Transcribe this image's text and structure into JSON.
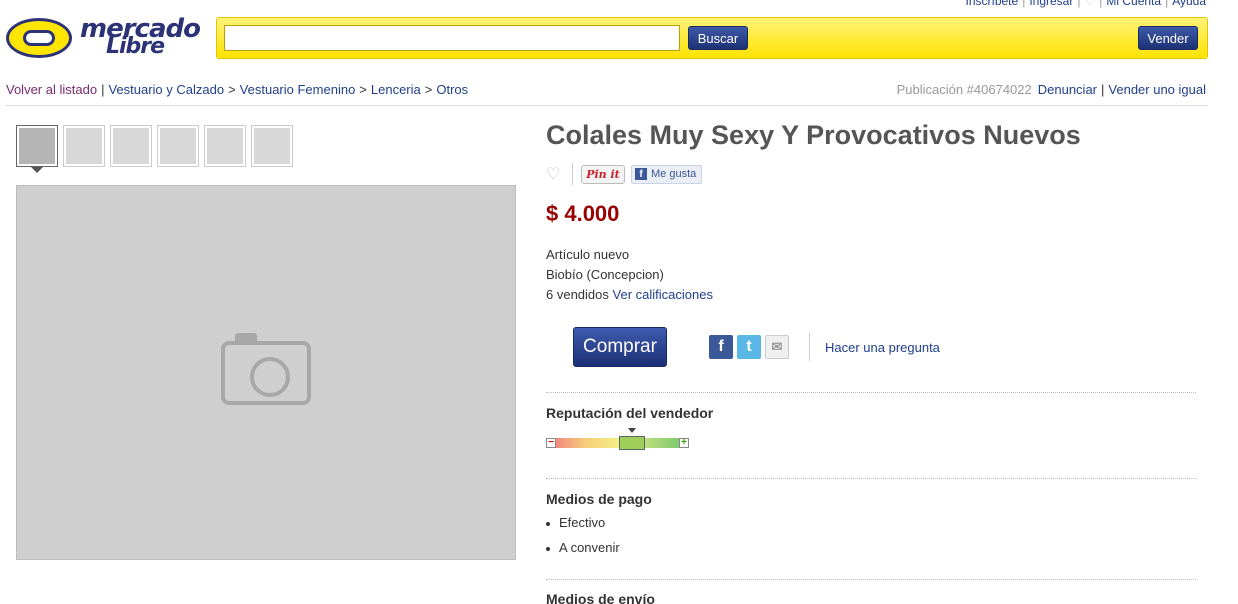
{
  "top_links": {
    "signup": "Inscríbete",
    "login": "Ingresar",
    "account": "Mi Cuenta",
    "help": "Ayuda"
  },
  "logo": {
    "line1": "mercado",
    "line2": "Libre"
  },
  "search": {
    "value": "",
    "placeholder": "",
    "button": "Buscar",
    "sell_button": "Vender"
  },
  "breadcrumb": {
    "back": "Volver al listado",
    "items": [
      "Vestuario y Calzado",
      "Vestuario Femenino",
      "Lenceria",
      "Otros"
    ],
    "publication": "Publicación #40674022",
    "report": "Denunciar",
    "sell_same": "Vender uno igual"
  },
  "gallery": {
    "thumbnail_count": 6,
    "selected_index": 0
  },
  "product": {
    "title": "Colales Muy Sexy Y Provocativos Nuevos",
    "price": "$ 4.000",
    "condition": "Artículo nuevo",
    "location": "Biobío (Concepcion)",
    "sold": "6 vendidos",
    "ratings_link": "Ver calificaciones",
    "buy_button": "Comprar",
    "ask_link": "Hacer una pregunta"
  },
  "social": {
    "pinit": "Pin it",
    "fb_like": "Me gusta"
  },
  "seller": {
    "reputation_title": "Reputación del vendedor",
    "reputation_level": 0.65
  },
  "payment": {
    "title": "Medios de pago",
    "methods": [
      "Efectivo",
      "A convenir"
    ]
  },
  "shipping": {
    "title": "Medios de envío"
  },
  "colors": {
    "brand_yellow": "#ffe600",
    "brand_blue": "#2d3277",
    "price_red": "#990000",
    "link_blue": "#1f3f8f"
  },
  "icons": [
    "favorite-heart-icon",
    "facebook-icon",
    "twitter-icon",
    "mail-icon",
    "reputation-minus-icon",
    "reputation-plus-icon"
  ]
}
